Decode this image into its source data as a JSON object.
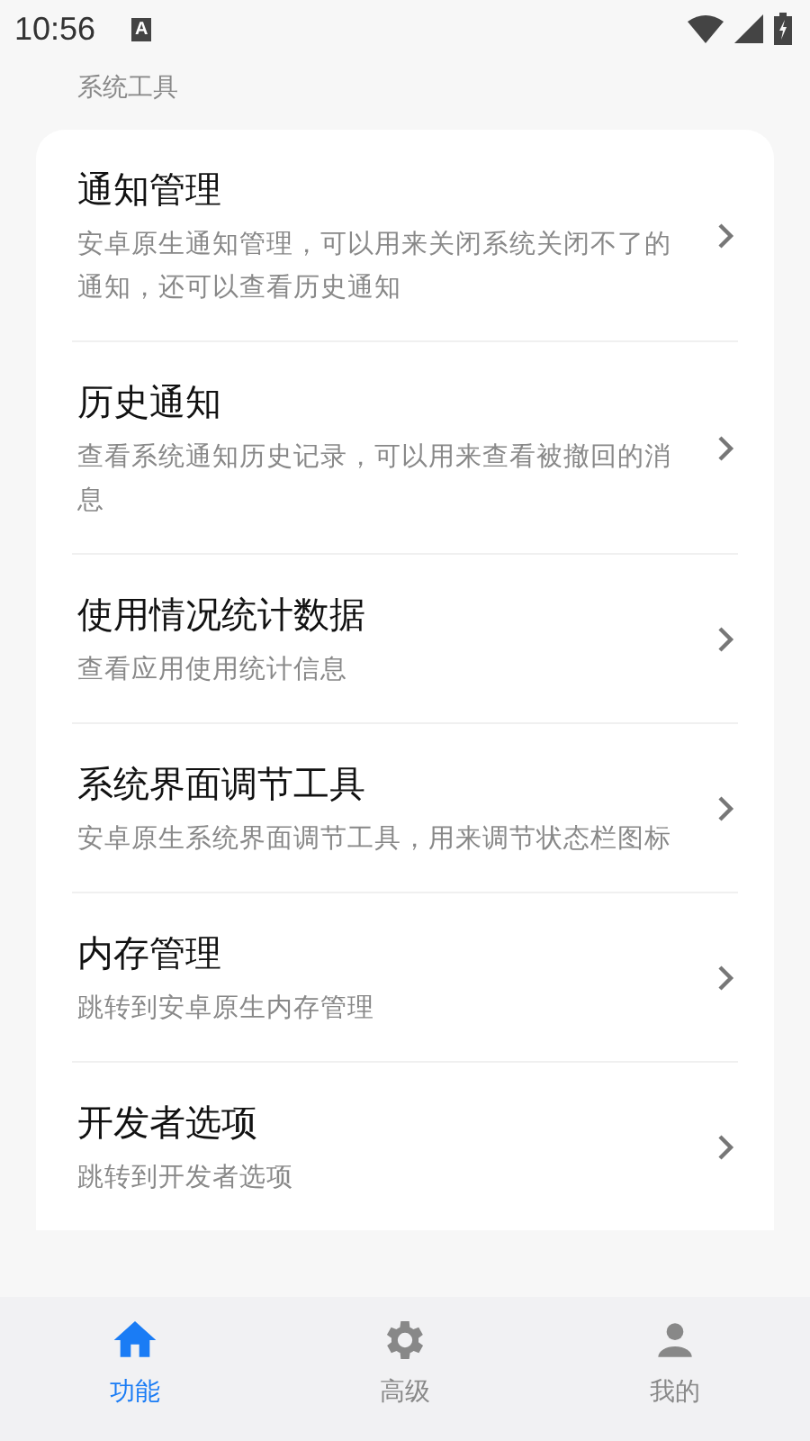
{
  "status_bar": {
    "time": "10:56",
    "notification": "A"
  },
  "section": {
    "title": "系统工具"
  },
  "items": [
    {
      "title": "通知管理",
      "description": "安卓原生通知管理，可以用来关闭系统关闭不了的通知，还可以查看历史通知"
    },
    {
      "title": "历史通知",
      "description": "查看系统通知历史记录，可以用来查看被撤回的消息"
    },
    {
      "title": "使用情况统计数据",
      "description": "查看应用使用统计信息"
    },
    {
      "title": "系统界面调节工具",
      "description": "安卓原生系统界面调节工具，用来调节状态栏图标"
    },
    {
      "title": "内存管理",
      "description": "跳转到安卓原生内存管理"
    },
    {
      "title": "开发者选项",
      "description": "跳转到开发者选项"
    }
  ],
  "tabs": [
    {
      "label": "功能",
      "selected": true
    },
    {
      "label": "高级",
      "selected": false
    },
    {
      "label": "我的",
      "selected": false
    }
  ]
}
